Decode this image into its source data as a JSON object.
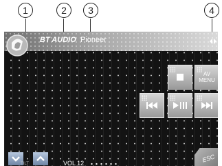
{
  "callouts": [
    "1",
    "2",
    "3",
    "4"
  ],
  "header": {
    "source_title": "BT AUDIO",
    "device_name": "Pioneer"
  },
  "buttons": {
    "av_menu_line1": "AV",
    "av_menu_line2": "MENU",
    "stop_icon": "stop-icon",
    "prev_icon": "skip-previous-icon",
    "play_pause_icon": "play-pause-icon",
    "next_icon": "skip-next-icon",
    "esc": "ESC"
  },
  "footer": {
    "volume": "VOL 12",
    "caption": "TILT",
    "down_icon": "chevron-down-icon",
    "up_icon": "chevron-up-icon"
  }
}
